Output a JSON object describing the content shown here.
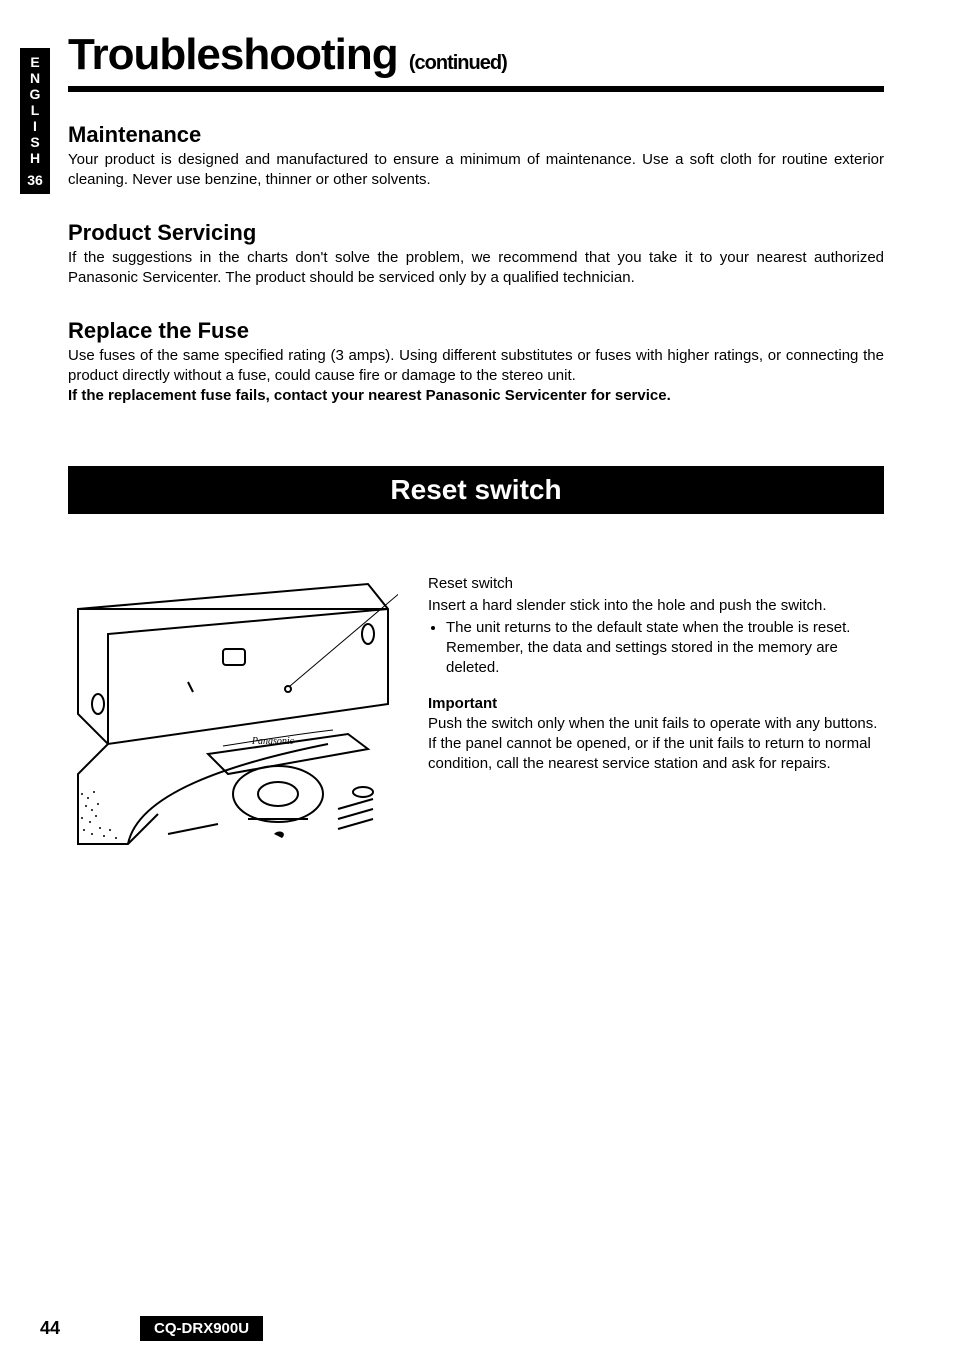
{
  "sideTab": {
    "language": "ENGLISH",
    "number": "36"
  },
  "title": {
    "main": "Troubleshooting",
    "continued": "(continued)"
  },
  "sections": {
    "maintenance": {
      "heading": "Maintenance",
      "body": "Your product is designed and manufactured to ensure a minimum of maintenance. Use a soft cloth for routine exterior cleaning. Never use benzine, thinner or other solvents."
    },
    "servicing": {
      "heading": "Product Servicing",
      "body": "If the suggestions in the charts don't solve the problem, we recommend that you take it to your nearest authorized Panasonic Servicenter. The product should be serviced only by a qualified technician."
    },
    "fuse": {
      "heading": "Replace the Fuse",
      "body": "Use fuses of the same specified rating (3 amps). Using different substitutes or fuses with higher ratings, or connecting the product directly without a fuse, could cause fire or damage to the stereo unit.",
      "bold": "If the replacement fuse fails, contact your nearest Panasonic Servicenter for service."
    }
  },
  "resetBar": "Reset switch",
  "reset": {
    "label": "Reset switch",
    "intro": "Insert a hard slender stick into the hole and push the switch.",
    "bullet": "The unit returns to the default state when the trouble is reset. Remember, the data and settings stored in the memory are deleted.",
    "importantHead": "Important",
    "important1": "Push the switch only when the unit fails to operate with any buttons.",
    "important2": "If the panel cannot be opened, or if the unit fails to return to normal condition, call the nearest service station and ask for repairs."
  },
  "diagram": {
    "brand": "Panasonic"
  },
  "footer": {
    "page": "44",
    "model": "CQ-DRX900U"
  }
}
